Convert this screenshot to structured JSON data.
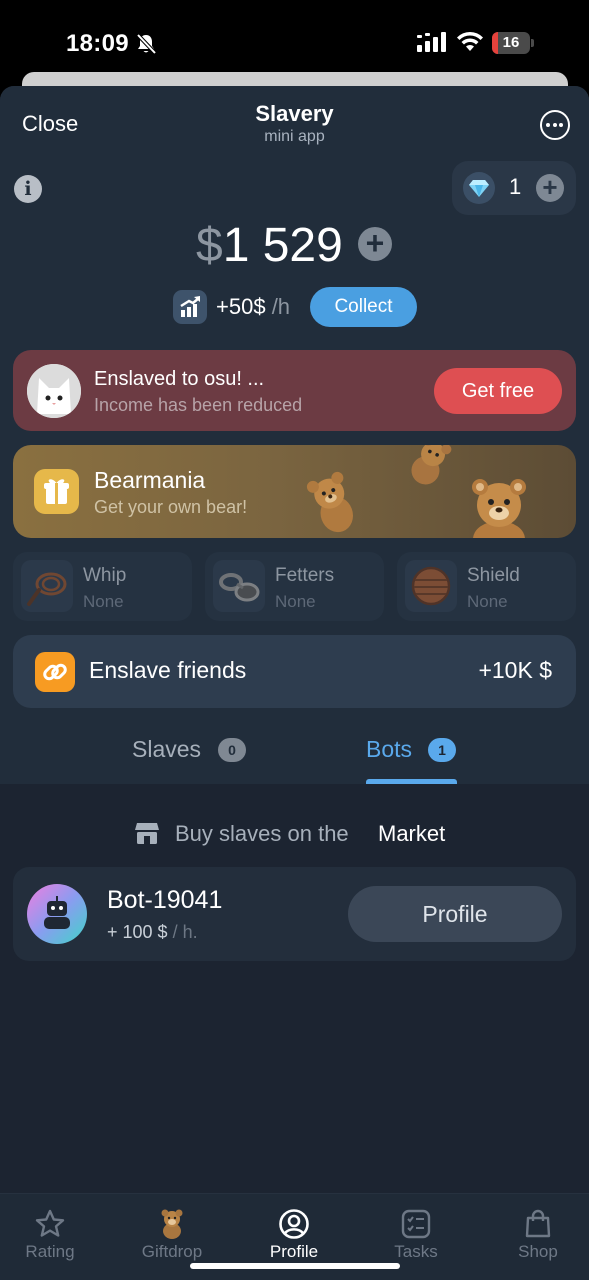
{
  "status_bar": {
    "time": "18:09",
    "battery_level": "16",
    "battery_fraction": 0.16,
    "icons": [
      "bell-slash-icon",
      "cellular-signal-icon",
      "wifi-icon",
      "battery-icon"
    ]
  },
  "header": {
    "close_label": "Close",
    "title": "Slavery",
    "subtitle": "mini app",
    "more_icon": "ellipsis-circle-icon"
  },
  "wallet": {
    "gems": "1",
    "gem_icon": "diamond-icon",
    "balance_currency": "$",
    "balance_amount": "1 529",
    "income_rate": "+50$",
    "income_unit": "/h",
    "collect_label": "Collect"
  },
  "enslaved_banner": {
    "title": "Enslaved to osu! ...",
    "subtitle": "Income has been reduced",
    "button_label": "Get free",
    "color": "#6c3b43"
  },
  "bear_banner": {
    "title": "Bearmania",
    "subtitle": "Get your own bear!"
  },
  "equipment": [
    {
      "name": "Whip",
      "value": "None",
      "icon": "whip-icon"
    },
    {
      "name": "Fetters",
      "value": "None",
      "icon": "fetters-icon"
    },
    {
      "name": "Shield",
      "value": "None",
      "icon": "shield-icon"
    }
  ],
  "friends": {
    "label": "Enslave friends",
    "bonus": "+10K $"
  },
  "tabs": [
    {
      "label": "Slaves",
      "count": "0",
      "active": false
    },
    {
      "label": "Bots",
      "count": "1",
      "active": true
    }
  ],
  "market": {
    "prefix": "Buy slaves on the",
    "link": "Market"
  },
  "bots": [
    {
      "name": "Bot-19041",
      "income": "+ 100 $",
      "income_unit": "/ h.",
      "button_label": "Profile"
    }
  ],
  "nav": [
    {
      "label": "Rating",
      "icon": "star-icon",
      "active": false
    },
    {
      "label": "Giftdrop",
      "icon": "teddy-bear-icon",
      "active": false
    },
    {
      "label": "Profile",
      "icon": "user-circle-icon",
      "active": true
    },
    {
      "label": "Tasks",
      "icon": "checklist-icon",
      "active": false
    },
    {
      "label": "Shop",
      "icon": "shopping-bag-icon",
      "active": false
    }
  ],
  "colors": {
    "accent": "#4a9fe1",
    "danger": "#de4f52",
    "background": "#1c2431",
    "link_icon": "#f79b22"
  }
}
